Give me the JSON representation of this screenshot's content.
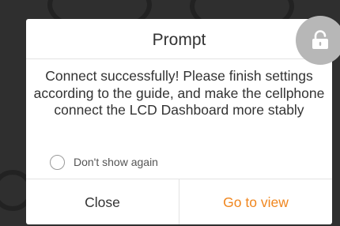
{
  "dialog": {
    "title": "Prompt",
    "message": "Connect successfully! Please finish settings according to the guide, and make the cellphone connect the LCD Dashboard more stably",
    "checkbox_label": "Don't show again",
    "checkbox_checked": false,
    "buttons": {
      "close_label": "Close",
      "view_label": "Go to view"
    }
  },
  "floating_button": {
    "icon": "unlock-icon"
  },
  "colors": {
    "accent": "#f0861e",
    "backdrop": "#2f2f2f",
    "floating_button": "#b7b7b7"
  }
}
